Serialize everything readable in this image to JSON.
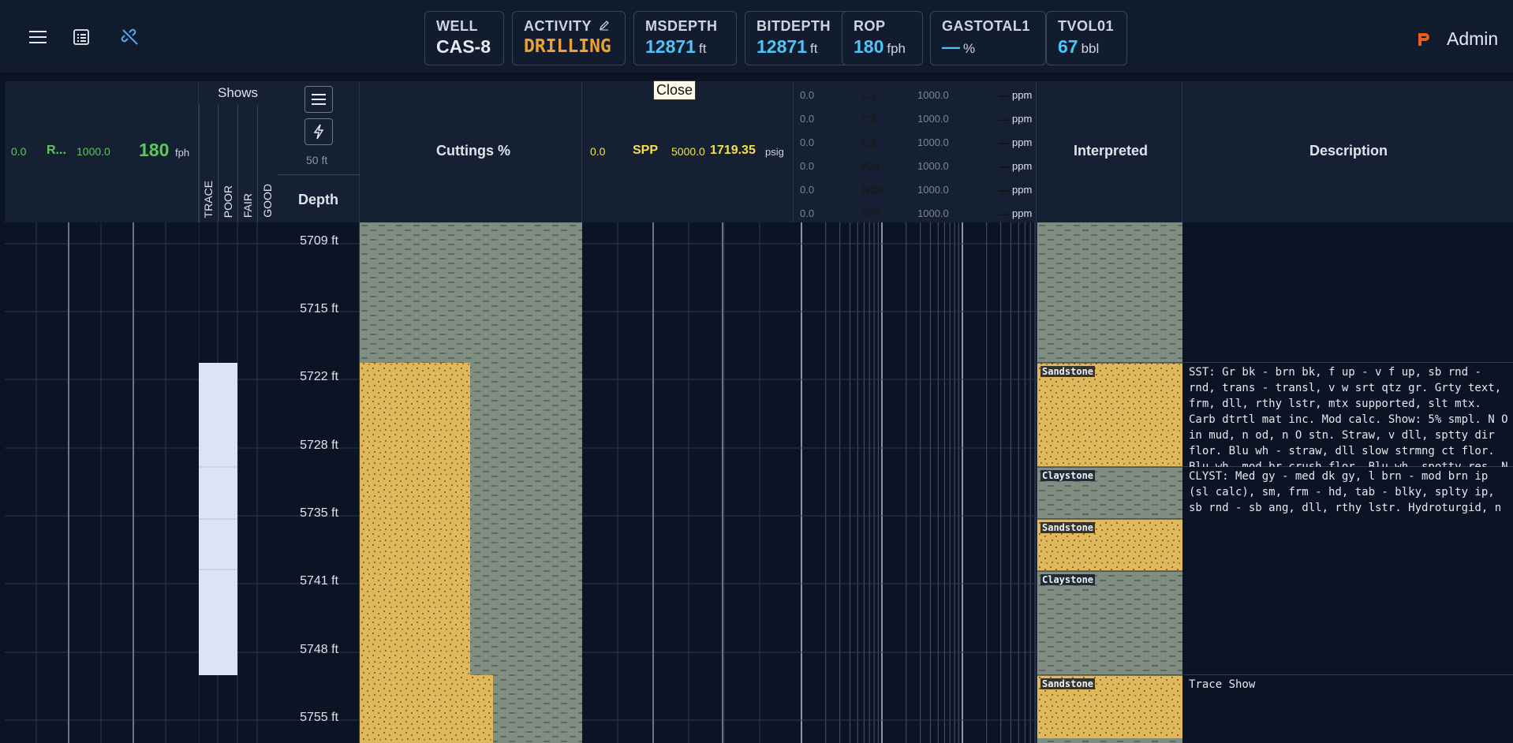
{
  "header": {
    "stats": [
      {
        "label": "WELL",
        "value": "CAS-8",
        "unit": ""
      },
      {
        "label": "ACTIVITY",
        "value": "DRILLING",
        "unit": ""
      },
      {
        "label": "MSDEPTH",
        "value": "12871",
        "unit": "ft"
      },
      {
        "label": "BITDEPTH",
        "value": "12871",
        "unit": "ft"
      },
      {
        "label": "ROP",
        "value": "180",
        "unit": "fph"
      },
      {
        "label": "GASTOTAL1",
        "value": "—",
        "unit": "%"
      },
      {
        "label": "TVOL01",
        "value": "67",
        "unit": "bbl"
      }
    ],
    "user": "Admin",
    "icons": [
      "menu-icon",
      "list-icon",
      "link-off-icon",
      "edit-icon"
    ]
  },
  "tooltip": "Close",
  "track_rop": {
    "min": "0.0",
    "name": "R...",
    "max": "1000.0",
    "value": "180",
    "unit": "fph"
  },
  "track_shows": {
    "title": "Shows",
    "levels": [
      "TRACE",
      "POOR",
      "FAIR",
      "GOOD"
    ]
  },
  "track_depth": {
    "title": "Depth",
    "scale": "50 ft",
    "labels": [
      "5709 ft",
      "5715 ft",
      "5722 ft",
      "5728 ft",
      "5735 ft",
      "5741 ft",
      "5748 ft",
      "5755 ft"
    ]
  },
  "track_cuttings": {
    "title": "Cuttings %"
  },
  "track_spp": {
    "min": "0.0",
    "name": "SPP",
    "max": "5000.0",
    "value": "1719.35",
    "unit": "psig"
  },
  "track_gas": {
    "rows": [
      {
        "min": "0.0",
        "name": "C1",
        "max": "1000.0",
        "value": "—",
        "unit": "ppm"
      },
      {
        "min": "0.0",
        "name": "C2",
        "max": "1000.0",
        "value": "—",
        "unit": "ppm"
      },
      {
        "min": "0.0",
        "name": "C3",
        "max": "1000.0",
        "value": "—",
        "unit": "ppm"
      },
      {
        "min": "0.0",
        "name": "IC4",
        "max": "1000.0",
        "value": "—",
        "unit": "ppm"
      },
      {
        "min": "0.0",
        "name": "NC4",
        "max": "1000.0",
        "value": "—",
        "unit": "ppm"
      },
      {
        "min": "0.0",
        "name": "IC5",
        "max": "1000.0",
        "value": "—",
        "unit": "ppm"
      }
    ]
  },
  "track_interpreted": {
    "title": "Interpreted",
    "layers": [
      "Sandstone",
      "Claystone",
      "Sandstone",
      "Claystone",
      "Sandstone"
    ]
  },
  "track_description": {
    "title": "Description",
    "entries": [
      "SST: Gr bk - brn bk, f up - v f up, sb rnd - rnd, trans - transl, v w srt qtz gr. Grty text, frm, dll, rthy lstr, mtx supported, slt mtx. Carb dtrtl mat inc. Mod calc. Show: 5% smpl. N O in mud, n od, n O stn. Straw, v dll, sptty dir flor. Blu wh - straw, dll slow strmng ct flor. Blu wh, mod br crush flor. Blu wh, spotty res. N",
      "CLYST: Med gy - med dk gy, l brn - mod brn ip (sl calc), sm, frm - hd, tab - blky, splty ip, sb rnd - sb ang, dll, rthy lstr. Hydroturgid, n",
      "Trace Show"
    ]
  },
  "colors": {
    "sand": "#e2b85c",
    "clay": "#7f8e80",
    "accent_blue": "#4fc3f7",
    "rop_green": "#5cc85c",
    "spp_yellow": "#f5e04a",
    "activity_orange": "#f0a030"
  }
}
